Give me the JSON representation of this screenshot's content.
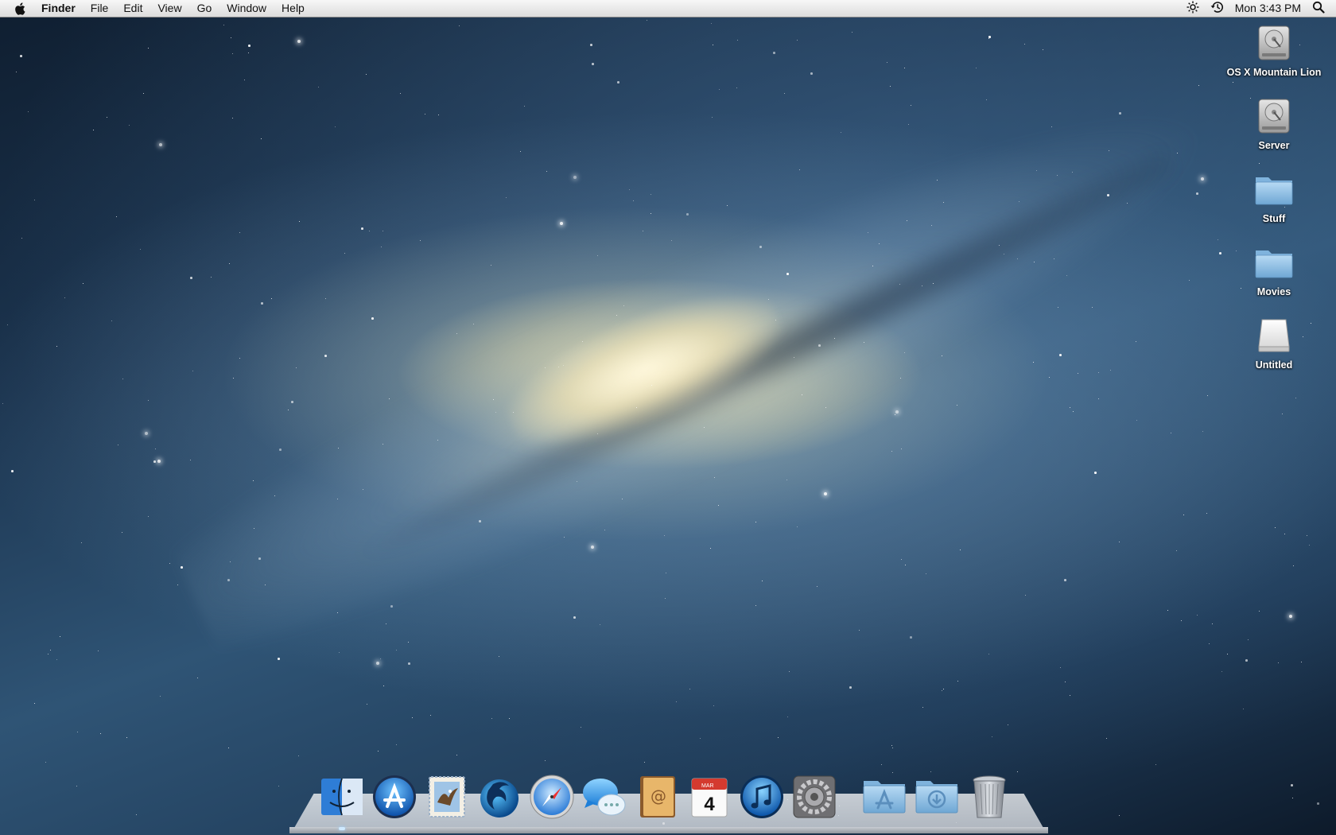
{
  "menubar": {
    "app_name": "Finder",
    "menus": [
      "File",
      "Edit",
      "View",
      "Go",
      "Window",
      "Help"
    ],
    "clock": "Mon 3:43 PM",
    "status_icons": [
      "brightness-icon",
      "time-machine-icon",
      "spotlight-icon"
    ]
  },
  "desktop_icons": [
    {
      "label": "OS X Mountain Lion",
      "icon": "hard-drive-icon"
    },
    {
      "label": "Server",
      "icon": "hard-drive-icon"
    },
    {
      "label": "Stuff",
      "icon": "folder-icon"
    },
    {
      "label": "Movies",
      "icon": "folder-icon"
    },
    {
      "label": "Untitled",
      "icon": "external-drive-icon"
    }
  ],
  "dock": {
    "apps": [
      {
        "name": "finder-icon"
      },
      {
        "name": "app-store-icon"
      },
      {
        "name": "mail-icon"
      },
      {
        "name": "mission-control-icon"
      },
      {
        "name": "safari-icon"
      },
      {
        "name": "messages-icon"
      },
      {
        "name": "contacts-icon"
      },
      {
        "name": "calendar-icon",
        "month": "MAR",
        "day": "4"
      },
      {
        "name": "itunes-icon"
      },
      {
        "name": "system-preferences-icon"
      }
    ],
    "stacks": [
      {
        "name": "applications-stack-icon"
      },
      {
        "name": "downloads-stack-icon"
      },
      {
        "name": "trash-icon"
      }
    ]
  },
  "colors": {
    "menubar_top": "#f7f7f7",
    "menubar_bottom": "#dcdcdc",
    "folder_blue": "#8fc1e6",
    "desktop_deep": "#1c3550"
  }
}
